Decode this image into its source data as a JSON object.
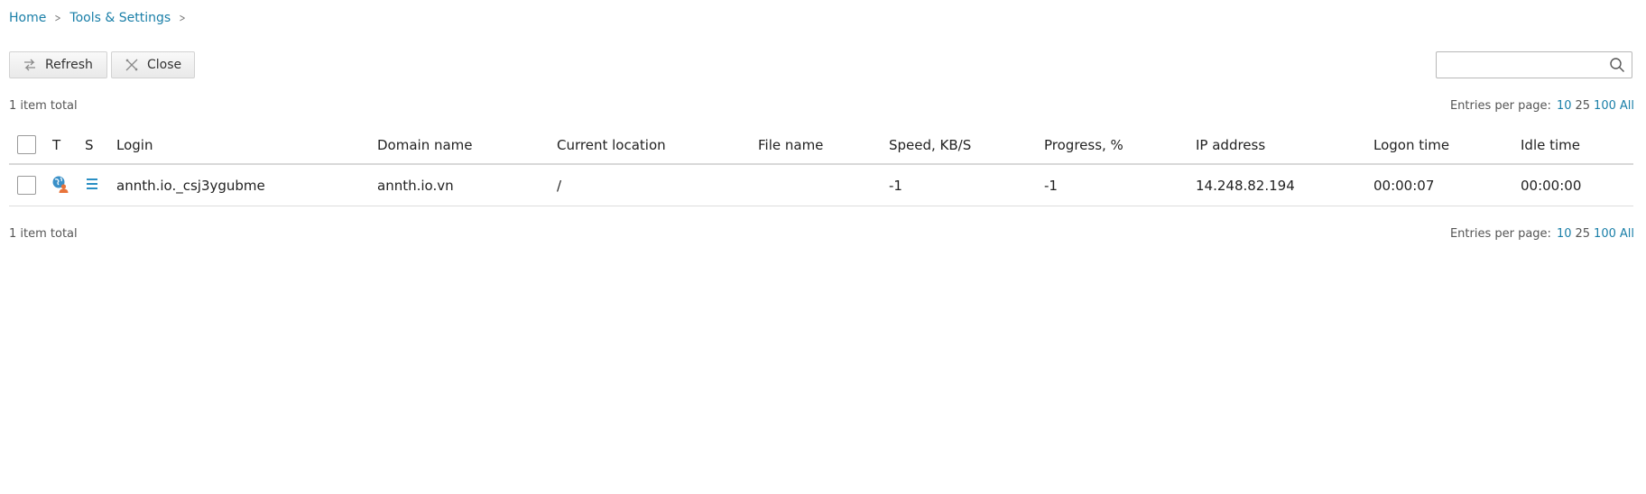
{
  "breadcrumb": {
    "home": "Home",
    "tools": "Tools & Settings"
  },
  "toolbar": {
    "refresh_label": "Refresh",
    "close_label": "Close"
  },
  "search": {
    "value": "",
    "placeholder": ""
  },
  "pagination": {
    "total_text": "1 item total",
    "entries_label": "Entries per page:",
    "options": [
      "10",
      "25",
      "100",
      "All"
    ],
    "selected": "25"
  },
  "table": {
    "headers": {
      "type": "T",
      "status": "S",
      "login": "Login",
      "domain": "Domain name",
      "location": "Current location",
      "file": "File name",
      "speed": "Speed, KB/S",
      "progress": "Progress, %",
      "ip": "IP address",
      "logon": "Logon time",
      "idle": "Idle time"
    },
    "rows": [
      {
        "type_icon": "ftp-user-globe-icon",
        "status_icon": "list-lines-icon",
        "login": "annth.io._csj3ygubme",
        "domain": "annth.io.vn",
        "location": "/",
        "file": "",
        "speed": "-1",
        "progress": "-1",
        "ip": "14.248.82.194",
        "logon": "00:00:07",
        "idle": "00:00:00"
      }
    ]
  },
  "colors": {
    "link": "#1a7fa8",
    "globe": "#3a90c8",
    "user": "#e8743b",
    "status_icon": "#2a8fc4"
  }
}
